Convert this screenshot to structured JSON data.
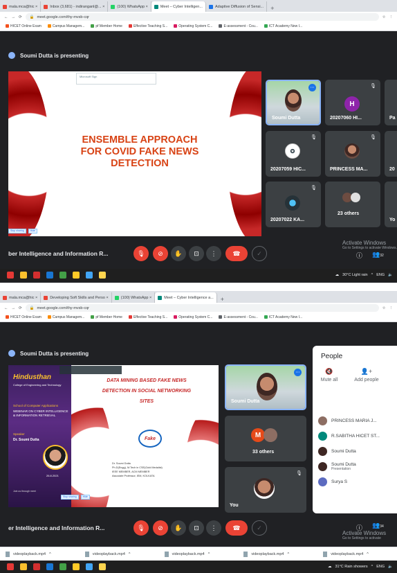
{
  "shot1": {
    "tabs": [
      {
        "label": "mala.mca@hic ×",
        "color": "#ea4335",
        "active": false
      },
      {
        "label": "Inbox (3,681) - indiranganl@... ×",
        "color": "#ea4335",
        "active": false
      },
      {
        "label": "(100) WhatsApp ×",
        "color": "#25d366",
        "active": false
      },
      {
        "label": "Meet – Cyber Intelligen...",
        "color": "#00897b",
        "active": true
      },
      {
        "label": "Adaptive Diffusion of Sensi...",
        "color": "#1a73e8",
        "active": false
      }
    ],
    "url": "meet.google.com/thy-mvsb-cqr",
    "bookmarks": [
      "HICET Online Exam",
      "Campus Managem...",
      "pf Member Home",
      "Effective Teaching S...",
      "Operating System C...",
      "E-assessment - Cou...",
      "ICT Academy New I..."
    ],
    "presenting": "Soumi Dutta is presenting",
    "slide": {
      "title": "ENSEMBLE APPROACH FOR COVID FAKE NEWS DETECTION",
      "chip": "Microsoft Sign",
      "toolbar": [
        "Stop sharing",
        "Hide"
      ]
    },
    "tiles": [
      {
        "name": "Soumi Dutta",
        "type": "video"
      },
      {
        "name": "20207060 HI...",
        "type": "letter",
        "letter": "H",
        "color": "#8e24aa"
      },
      {
        "name": "Pa",
        "type": "cut"
      },
      {
        "name": "20207059 HIC...",
        "type": "logo"
      },
      {
        "name": "PRINCESS MA...",
        "type": "photo"
      },
      {
        "name": "20",
        "type": "cut"
      },
      {
        "name": "20207022 KA...",
        "type": "photo2"
      },
      {
        "name": "23 others",
        "type": "group"
      },
      {
        "name": "Yo",
        "type": "cut"
      }
    ],
    "meeting_name": "ber Intelligence and Information R...",
    "activate": "Activate Windows",
    "activate_sub": "Go to Settings to activate Windows.",
    "people_count": "32",
    "tray": "30°C Light rain",
    "tray_lang": "ENG"
  },
  "shot2": {
    "tabs": [
      {
        "label": "mala.mca@hic ×",
        "color": "#ea4335",
        "active": false
      },
      {
        "label": "Developing Soft Skills and Perso ×",
        "color": "#ea4335",
        "active": false
      },
      {
        "label": "(100) WhatsApp ×",
        "color": "#25d366",
        "active": false
      },
      {
        "label": "Meet – Cyber Intelligence a...",
        "color": "#00897b",
        "active": true
      }
    ],
    "url": "meet.google.com/thy-mvsb-cqr",
    "bookmarks": [
      "HICET Online Exam",
      "Campus Managem...",
      "pf Member Home",
      "Effective Teaching S...",
      "Operating System C...",
      "E-assessment - Cou...",
      "ICT Academy New I..."
    ],
    "presenting": "Soumi Dutta is presenting",
    "poster": {
      "college": "Hindusthan",
      "college_sub": "College of Engineering and Technology",
      "school": "School of Computer Applications",
      "webinar": "WEBINAR ON CYBER INTELLIGENCE & INFORMATION RETRIEVAL",
      "speaker_label": "Speaker",
      "speaker": "Dr. Soumi Dutta",
      "date": "26.8.2021",
      "footer": "Join us through meet"
    },
    "slide": {
      "title": "DATA MINING BASED FAKE NEWS DETECTION IN SOCIAL NETWORKING SITES",
      "logo": "Fake",
      "author": "Dr. Soumi Dutta",
      "author_line2": "Ph.D(Engg), M.Tech in CSE(Gold Medalist)",
      "author_line3": "IEEE MEMBER, ACM MEMBER",
      "author_line4": "Associate Professor, IEM, KOLKATA",
      "toolbar": [
        "Stop sharing",
        "Hide"
      ]
    },
    "tiles": [
      {
        "name": "Soumi Dutta",
        "type": "video"
      },
      {
        "name": "33 others",
        "type": "group"
      },
      {
        "name": "You",
        "type": "self"
      }
    ],
    "people_panel": {
      "title": "People",
      "actions": [
        "Mute all",
        "Add people"
      ],
      "rows": [
        {
          "name": "PRINCESS MARIA J...",
          "sub": "",
          "color": "#8d6e63"
        },
        {
          "name": "R.SABITHA HICET ST...",
          "sub": "",
          "color": "#00897b"
        },
        {
          "name": "Soumi Dutta",
          "sub": "",
          "color": "#3e2723"
        },
        {
          "name": "Soumi Dutta",
          "sub": "Presentation",
          "color": "#3e2723"
        },
        {
          "name": "Surya S",
          "sub": "",
          "color": "#5c6bc0"
        }
      ]
    },
    "meeting_name": "er Intelligence and Information R...",
    "activate": "Activate Windows",
    "activate_sub": "Go to Settings to activate",
    "people_count": "34",
    "downloads": [
      "videoplayback.mp4",
      "videoplayback.mp4",
      "videoplayback.mp4",
      "videoplayback.mp4",
      "videoplayback.mp4"
    ],
    "tray": "31°C Rain showers",
    "tray_lang": "ENG"
  }
}
